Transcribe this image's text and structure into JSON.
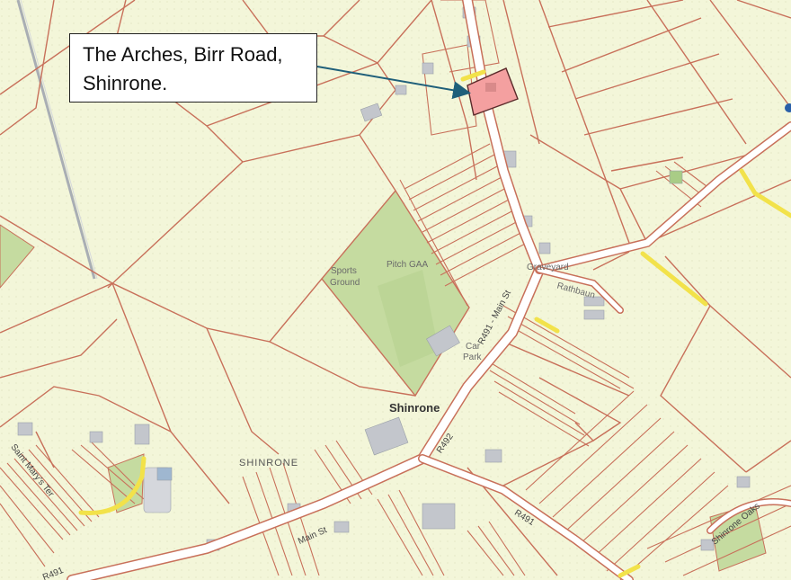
{
  "callout": {
    "line1": "The Arches, Birr Road,",
    "line2": "Shinrone."
  },
  "labels": {
    "sports_ground_1": "Sports",
    "sports_ground_2": "Ground",
    "pitch": "Pitch GAA",
    "graveyard": "Graveyard",
    "rathbaun": "Rathbaun",
    "car_park_1": "Car",
    "car_park_2": "Park",
    "town": "Shinrone",
    "townland": "SHINRONE",
    "r491_main_st": "R491 - Main St",
    "r492": "R492",
    "main_st": "Main St",
    "r491_east": "R491",
    "r491_west": "R491",
    "shinrone_oaks": "Shinrone Oaks",
    "saint_marys": "Saint Mary's Ter"
  },
  "colors": {
    "map_background": "#f3f6d9",
    "parcel_line": "#c8705a",
    "green_field": "#c5dba0",
    "subject_site": "#f4a0a0",
    "yellow_road": "#f2e24a",
    "arrow": "#1f5f7a"
  }
}
